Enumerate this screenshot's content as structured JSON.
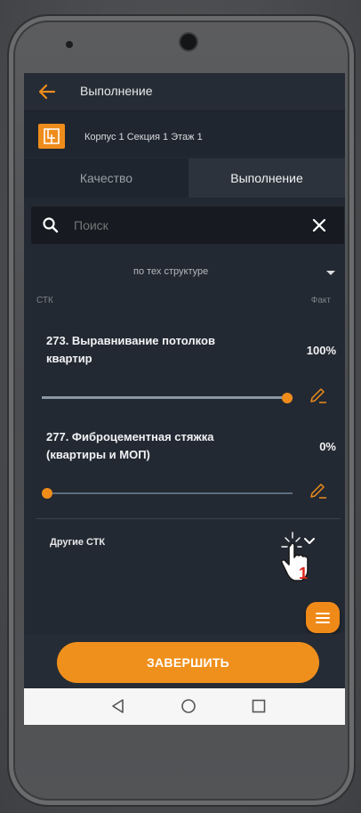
{
  "appbar": {
    "title": "Выполнение",
    "back_icon": "arrow-left-icon",
    "accent": "#ee8c1c"
  },
  "object": {
    "title": "Корпус 1 Секция 1 Этаж 1",
    "logo_icon": "building-logo-icon"
  },
  "tabs": [
    {
      "label": "Качество",
      "active": false
    },
    {
      "label": "Выполнение",
      "active": true
    }
  ],
  "search": {
    "value": "",
    "placeholder": "Поиск"
  },
  "filter": {
    "selected": "по тех структуре"
  },
  "columns": {
    "left": "СТК",
    "right": "Факт"
  },
  "tasks": [
    {
      "title": "273. Выравнивание потолков квартир",
      "percent_label": "100%",
      "progress": 1.0
    },
    {
      "title": "277. Фиброцементная стяжка (квартиры и МОП)",
      "percent_label": "0%",
      "progress": 0.0
    }
  ],
  "other": {
    "label": "Другие СТК",
    "icon": "chevron-down-icon"
  },
  "hint": {
    "step": "1"
  },
  "footer": {
    "finish_label": "ЗАВЕРШИТЬ"
  },
  "fab": {
    "icon": "menu-icon"
  },
  "colors": {
    "accent": "#f08c1a",
    "background": "#232932",
    "surface": "#2c333d"
  }
}
